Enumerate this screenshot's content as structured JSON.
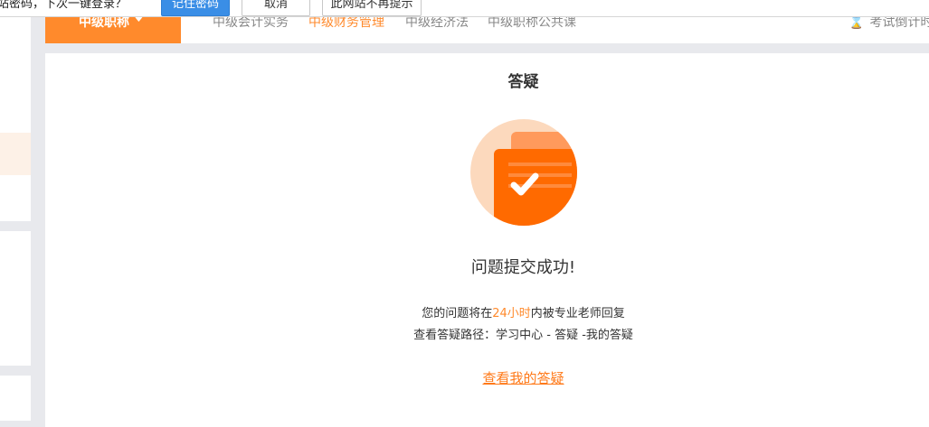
{
  "password_prompt": {
    "message": "是否让网站记住此网站密码，下次一键登录？",
    "remember_label": "记住密码",
    "cancel_label": "取消",
    "never_label": "此网站不再提示"
  },
  "nav": {
    "category_label": "中级职称",
    "tabs": [
      {
        "label": "中级会计实务",
        "active": false
      },
      {
        "label": "中级财务管理",
        "active": true
      },
      {
        "label": "中级经济法",
        "active": false
      },
      {
        "label": "中级职称公共课",
        "active": false
      }
    ],
    "countdown_label": "考试倒计时"
  },
  "main": {
    "title": "答疑",
    "success_message": "问题提交成功!",
    "reply_prefix": "您的问题将在",
    "reply_highlight": "24小时",
    "reply_suffix": "内被专业老师回复",
    "path_text": "查看答疑路径：学习中心 - 答疑 -我的答疑",
    "view_link": "查看我的答疑"
  },
  "colors": {
    "accent": "#ff8a2c",
    "icon_circle": "#fcd9bd",
    "icon_doc": "#ff6a00",
    "icon_doc_back": "#ff9a5c"
  }
}
